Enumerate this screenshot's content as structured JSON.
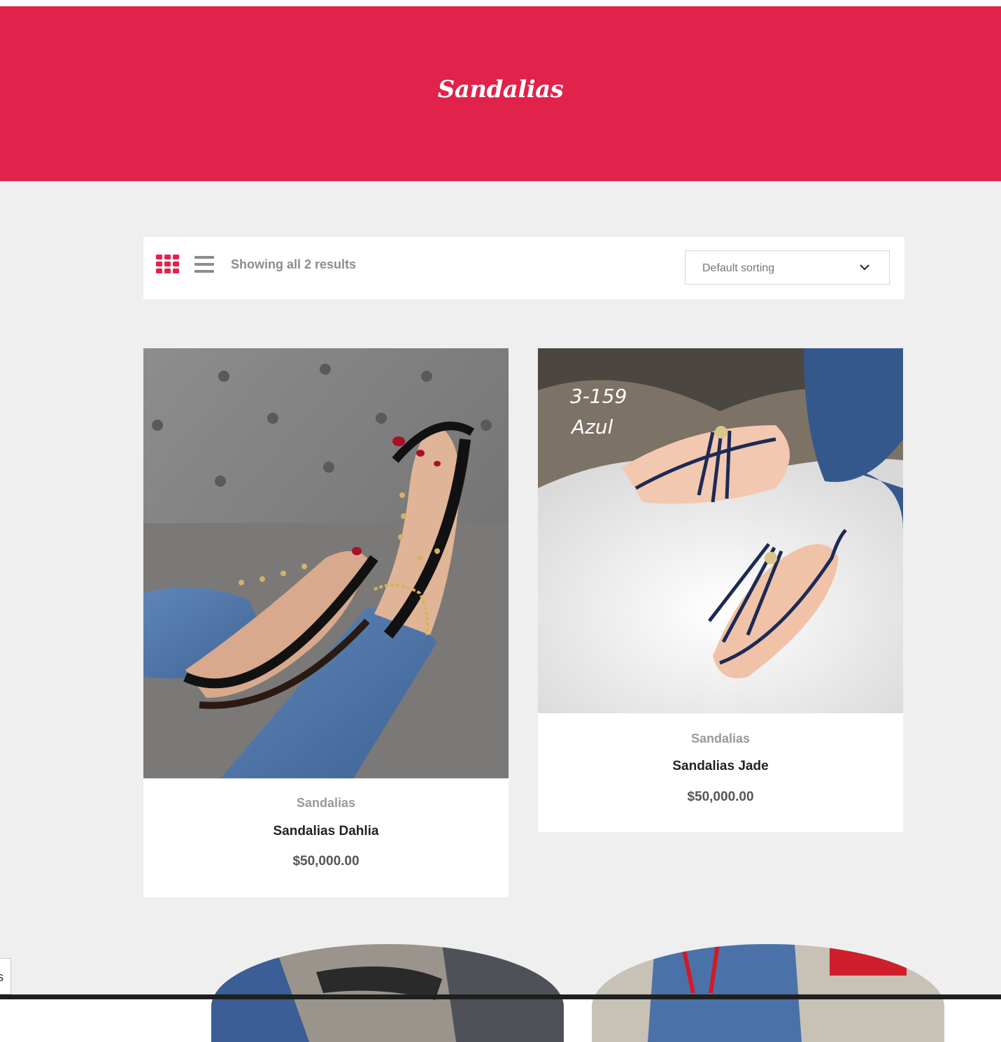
{
  "header": {
    "title": "Sandalias"
  },
  "toolbar": {
    "grid_view_icon": "grid-view-icon",
    "list_view_icon": "list-view-icon",
    "results_text": "Showing all 2 results",
    "sorting": {
      "selected": "Default sorting",
      "icon": "chevron-down-icon"
    }
  },
  "products": [
    {
      "category": "Sandalias",
      "name": "Sandalias Dahlia",
      "price": "$50,000.00",
      "image": "black studded thong sandals on jeans"
    },
    {
      "category": "Sandalias",
      "name": "Sandalias Jade",
      "price": "$50,000.00",
      "image": "navy fringe sandals on white fur",
      "image_text": [
        "3-159",
        "Azul"
      ]
    }
  ],
  "side_tab": {
    "text": "s"
  },
  "colors": {
    "accent": "#e1224a",
    "page_bg": "#efefef"
  }
}
